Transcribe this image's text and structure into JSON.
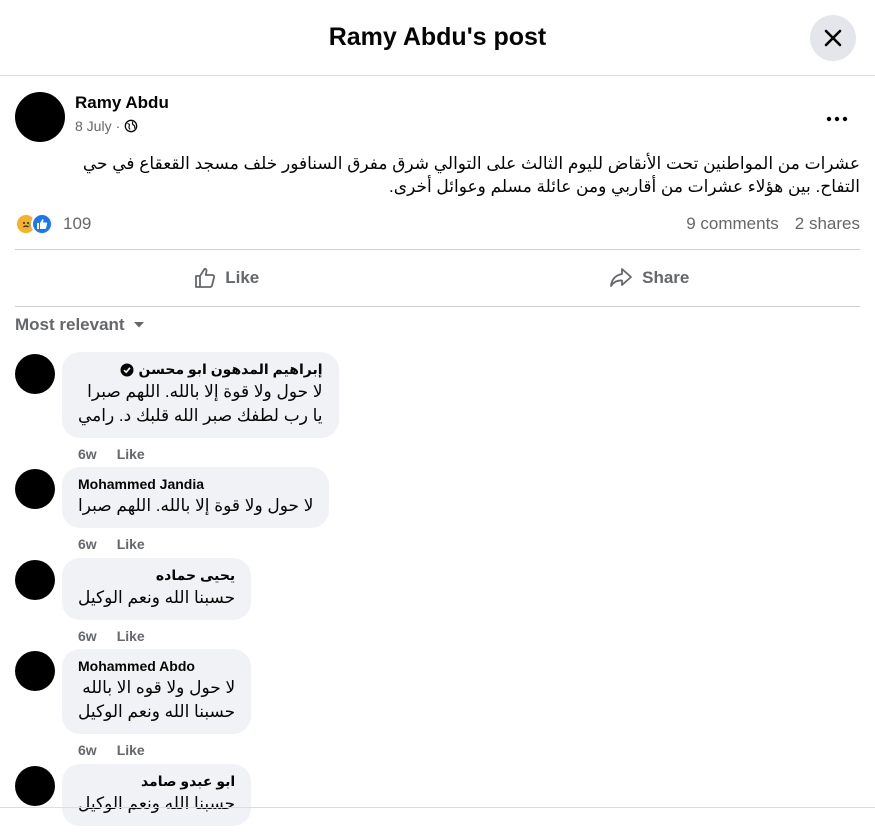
{
  "header": {
    "title": "Ramy Abdu's post"
  },
  "post": {
    "author": "Ramy Abdu",
    "date": "8 July",
    "separator": "·",
    "text_line1": "عشرات من المواطنين تحت الأنقاض لليوم الثالث على التوالي شرق مفرق السنافور خلف مسجد القعقاع في حي",
    "text_line2": "التفاح. بين هؤلاء عشرات من أقاربي ومن عائلة مسلم وعوائل أخرى.",
    "reaction_count": "109",
    "comments_count": "9 comments",
    "shares_count": "2 shares",
    "like_label": "Like",
    "share_label": "Share"
  },
  "sort_label": "Most relevant",
  "comments": [
    {
      "name": "إبراهيم المدهون ابو محسن",
      "verified": true,
      "text_line1": "لا حول ولا قوة إلا بالله. اللهم صبرا",
      "text_line2": "يا رب لطفك صبر الله قلبك د. رامي",
      "time": "6w",
      "like": "Like"
    },
    {
      "name": "Mohammed Jandia",
      "text_line1": "لا حول ولا قوة إلا بالله. اللهم صبرا",
      "time": "6w",
      "like": "Like"
    },
    {
      "name": "يحيى حماده",
      "text_line1": "حسبنا الله ونعم الوكيل",
      "time": "6w",
      "like": "Like"
    },
    {
      "name": "Mohammed Abdo",
      "text_line1": "لا حول ولا قوه الا بالله",
      "text_line2": "حسبنا الله ونعم الوكيل",
      "time": "6w",
      "like": "Like"
    },
    {
      "name": "ابو عبدو صامد",
      "text_line1": "حسبنا الله ونعم الوكيل"
    }
  ],
  "colors": {
    "accent": "#1877f2",
    "secondary_text": "#65676b",
    "bubble": "#f0f2f5"
  },
  "icons": [
    "close-icon",
    "globe-icon",
    "more-icon",
    "care-reaction-icon",
    "like-reaction-icon",
    "like-icon",
    "share-icon",
    "dropdown-icon",
    "verified-icon"
  ]
}
